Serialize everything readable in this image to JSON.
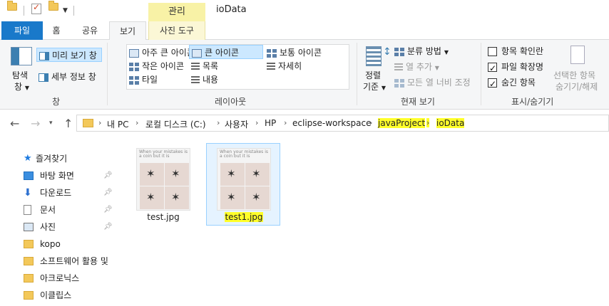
{
  "titlebar": {
    "manage_tab": "관리",
    "title": "ioData"
  },
  "tabs": {
    "file": "파일",
    "home": "홈",
    "share": "공유",
    "view": "보기",
    "picture_tools": "사진 도구"
  },
  "ribbon": {
    "pane_group": {
      "nav_pane_line1": "탐색",
      "nav_pane_line2": "창",
      "preview_pane": "미리 보기 창",
      "details_pane": "세부 정보 창",
      "label": "창"
    },
    "layout_group": {
      "extra_large": "아주 큰 아이콘",
      "large": "큰 아이콘",
      "medium": "보통 아이콘",
      "small": "작은 아이콘",
      "list": "목록",
      "details": "자세히",
      "tiles": "타일",
      "content": "내용",
      "label": "레이아웃"
    },
    "current_view_group": {
      "sort_line1": "정렬",
      "sort_line2": "기준",
      "group_by": "분류 방법",
      "add_columns": "열 추가",
      "fit_columns": "모든 열 너비 조정",
      "label": "현재 보기"
    },
    "show_hide_group": {
      "item_checkboxes": "항목 확인란",
      "file_extensions": "파일 확장명",
      "hidden_items": "숨긴 항목",
      "hide_selected_line1": "선택한 항목",
      "hide_selected_line2": "숨기기/해제",
      "label": "표시/숨기기",
      "checks": {
        "item_checkboxes": false,
        "file_extensions": true,
        "hidden_items": true
      }
    }
  },
  "address": {
    "crumbs": [
      "내 PC",
      "로컬 디스크 (C:)",
      "사용자",
      "HP",
      "eclipse-workspace",
      "javaProject",
      "ioData"
    ]
  },
  "sidebar": {
    "items": [
      {
        "label": "즐겨찾기",
        "icon": "star-icon",
        "pinned": false
      },
      {
        "label": "바탕 화면",
        "icon": "desktop-icon",
        "pinned": true
      },
      {
        "label": "다운로드",
        "icon": "download-icon",
        "pinned": true
      },
      {
        "label": "문서",
        "icon": "document-icon",
        "pinned": true
      },
      {
        "label": "사진",
        "icon": "picture-icon",
        "pinned": true
      },
      {
        "label": "kopo",
        "icon": "folder-icon",
        "pinned": false
      },
      {
        "label": "소프트웨어 활용 및",
        "icon": "folder-icon",
        "pinned": false
      },
      {
        "label": "아크로닉스",
        "icon": "folder-icon",
        "pinned": false
      },
      {
        "label": "이클립스",
        "icon": "folder-icon",
        "pinned": false
      }
    ]
  },
  "files": [
    {
      "name": "test.jpg",
      "selected": false
    },
    {
      "name": "test1.jpg",
      "selected": true
    }
  ],
  "thumbnail_caption": "When your mistakes is a coin but it is"
}
